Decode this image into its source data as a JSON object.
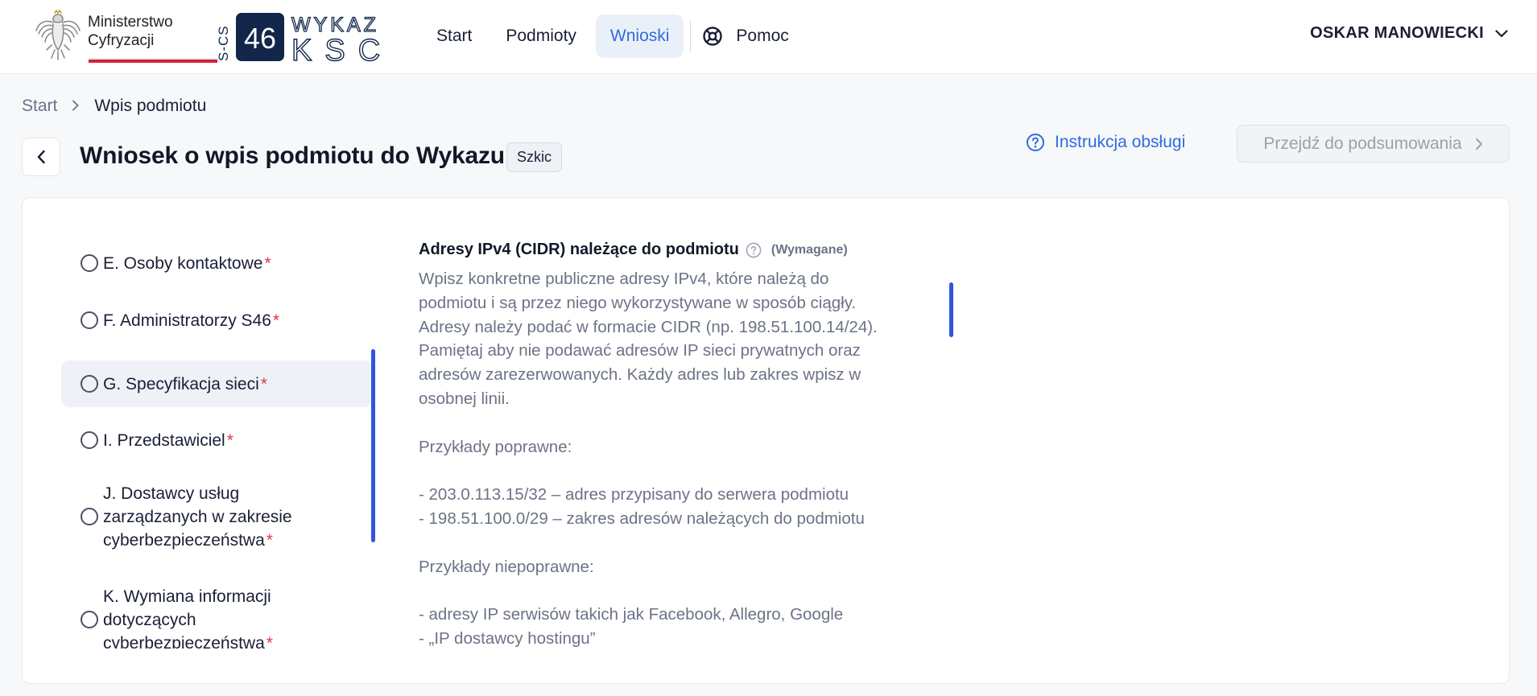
{
  "header": {
    "ministry_line1": "Ministerstwo",
    "ministry_line2": "Cyfryzacji",
    "logo_number": "46",
    "logo_side_text": "S-CS",
    "logo_word_top": "WYKAZ",
    "logo_word_bottom": "KSC",
    "nav": {
      "start": "Start",
      "podmioty": "Podmioty",
      "wnioski": "Wnioski",
      "pomoc": "Pomoc"
    },
    "active_nav": "Wnioski",
    "user_name": "OSKAR MANOWIECKI"
  },
  "breadcrumb": {
    "home": "Start",
    "current": "Wpis podmiotu"
  },
  "page": {
    "title": "Wniosek o wpis podmiotu do Wykazu",
    "status_badge": "Szkic",
    "manual_link": "Instrukcja obsługi",
    "summary_button": "Przejdź do podsumowania"
  },
  "steps": [
    {
      "label": "E. Osoby kontaktowe",
      "required": true,
      "active": false
    },
    {
      "label": "F. Administratorzy S46",
      "required": true,
      "active": false
    },
    {
      "label": "G. Specyfikacja sieci",
      "required": true,
      "active": true
    },
    {
      "label": "I. Przedstawiciel",
      "required": true,
      "active": false
    },
    {
      "label": "J. Dostawcy usług zarządzanych w zakresie cyberbezpieczeństwa",
      "required": true,
      "active": false
    },
    {
      "label": "K. Wymiana informacji dotyczących cyberbezpieczeństwa",
      "required": true,
      "active": false
    }
  ],
  "required_marker": "*",
  "field": {
    "title": "Adresy IPv4 (CIDR) należące do podmiotu",
    "required_label": "(Wymagane)",
    "description": "Wpisz konkretne publiczne adresy IPv4, które należą do\npodmiotu i są przez niego wykorzystywane w sposób ciągły.\nAdresy należy podać w formacie CIDR (np. 198.51.100.14/24).\nPamiętaj aby nie podawać adresów IP sieci prywatnych oraz\nadresów zarezerwowanych. Każdy adres lub zakres wpisz w\nosobnej linii.\n\nPrzykłady poprawne:\n\n- 203.0.113.15/32 – adres przypisany do serwera podmiotu\n- 198.51.100.0/29 – zakres adresów należących do podmiotu\n\nPrzykłady niepoprawne:\n\n- adresy IP serwisów takich jak Facebook, Allegro, Google\n- „IP dostawcy hostingu”"
  },
  "colors": {
    "accent": "#2f6be0",
    "scrollbar": "#2f56e0",
    "required_star": "#e0364a",
    "ministry_red": "#d4213d",
    "logo_navy": "#12264a"
  }
}
